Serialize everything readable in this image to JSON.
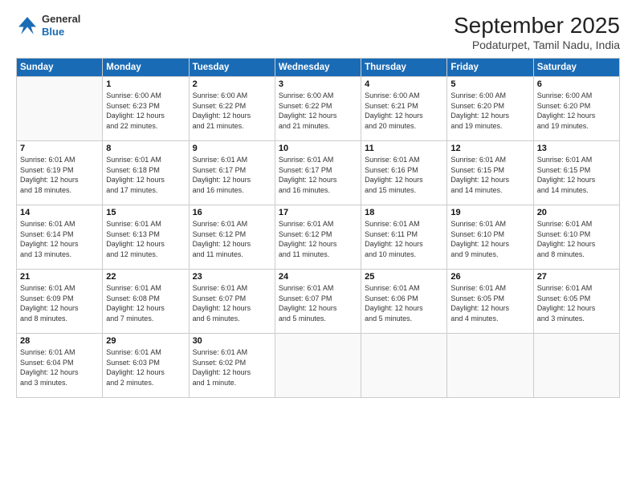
{
  "header": {
    "logo_line1": "General",
    "logo_line2": "Blue",
    "title": "September 2025",
    "subtitle": "Podaturpet, Tamil Nadu, India"
  },
  "weekdays": [
    "Sunday",
    "Monday",
    "Tuesday",
    "Wednesday",
    "Thursday",
    "Friday",
    "Saturday"
  ],
  "weeks": [
    [
      {
        "day": "",
        "info": ""
      },
      {
        "day": "1",
        "info": "Sunrise: 6:00 AM\nSunset: 6:23 PM\nDaylight: 12 hours\nand 22 minutes."
      },
      {
        "day": "2",
        "info": "Sunrise: 6:00 AM\nSunset: 6:22 PM\nDaylight: 12 hours\nand 21 minutes."
      },
      {
        "day": "3",
        "info": "Sunrise: 6:00 AM\nSunset: 6:22 PM\nDaylight: 12 hours\nand 21 minutes."
      },
      {
        "day": "4",
        "info": "Sunrise: 6:00 AM\nSunset: 6:21 PM\nDaylight: 12 hours\nand 20 minutes."
      },
      {
        "day": "5",
        "info": "Sunrise: 6:00 AM\nSunset: 6:20 PM\nDaylight: 12 hours\nand 19 minutes."
      },
      {
        "day": "6",
        "info": "Sunrise: 6:00 AM\nSunset: 6:20 PM\nDaylight: 12 hours\nand 19 minutes."
      }
    ],
    [
      {
        "day": "7",
        "info": "Sunrise: 6:01 AM\nSunset: 6:19 PM\nDaylight: 12 hours\nand 18 minutes."
      },
      {
        "day": "8",
        "info": "Sunrise: 6:01 AM\nSunset: 6:18 PM\nDaylight: 12 hours\nand 17 minutes."
      },
      {
        "day": "9",
        "info": "Sunrise: 6:01 AM\nSunset: 6:17 PM\nDaylight: 12 hours\nand 16 minutes."
      },
      {
        "day": "10",
        "info": "Sunrise: 6:01 AM\nSunset: 6:17 PM\nDaylight: 12 hours\nand 16 minutes."
      },
      {
        "day": "11",
        "info": "Sunrise: 6:01 AM\nSunset: 6:16 PM\nDaylight: 12 hours\nand 15 minutes."
      },
      {
        "day": "12",
        "info": "Sunrise: 6:01 AM\nSunset: 6:15 PM\nDaylight: 12 hours\nand 14 minutes."
      },
      {
        "day": "13",
        "info": "Sunrise: 6:01 AM\nSunset: 6:15 PM\nDaylight: 12 hours\nand 14 minutes."
      }
    ],
    [
      {
        "day": "14",
        "info": "Sunrise: 6:01 AM\nSunset: 6:14 PM\nDaylight: 12 hours\nand 13 minutes."
      },
      {
        "day": "15",
        "info": "Sunrise: 6:01 AM\nSunset: 6:13 PM\nDaylight: 12 hours\nand 12 minutes."
      },
      {
        "day": "16",
        "info": "Sunrise: 6:01 AM\nSunset: 6:12 PM\nDaylight: 12 hours\nand 11 minutes."
      },
      {
        "day": "17",
        "info": "Sunrise: 6:01 AM\nSunset: 6:12 PM\nDaylight: 12 hours\nand 11 minutes."
      },
      {
        "day": "18",
        "info": "Sunrise: 6:01 AM\nSunset: 6:11 PM\nDaylight: 12 hours\nand 10 minutes."
      },
      {
        "day": "19",
        "info": "Sunrise: 6:01 AM\nSunset: 6:10 PM\nDaylight: 12 hours\nand 9 minutes."
      },
      {
        "day": "20",
        "info": "Sunrise: 6:01 AM\nSunset: 6:10 PM\nDaylight: 12 hours\nand 8 minutes."
      }
    ],
    [
      {
        "day": "21",
        "info": "Sunrise: 6:01 AM\nSunset: 6:09 PM\nDaylight: 12 hours\nand 8 minutes."
      },
      {
        "day": "22",
        "info": "Sunrise: 6:01 AM\nSunset: 6:08 PM\nDaylight: 12 hours\nand 7 minutes."
      },
      {
        "day": "23",
        "info": "Sunrise: 6:01 AM\nSunset: 6:07 PM\nDaylight: 12 hours\nand 6 minutes."
      },
      {
        "day": "24",
        "info": "Sunrise: 6:01 AM\nSunset: 6:07 PM\nDaylight: 12 hours\nand 5 minutes."
      },
      {
        "day": "25",
        "info": "Sunrise: 6:01 AM\nSunset: 6:06 PM\nDaylight: 12 hours\nand 5 minutes."
      },
      {
        "day": "26",
        "info": "Sunrise: 6:01 AM\nSunset: 6:05 PM\nDaylight: 12 hours\nand 4 minutes."
      },
      {
        "day": "27",
        "info": "Sunrise: 6:01 AM\nSunset: 6:05 PM\nDaylight: 12 hours\nand 3 minutes."
      }
    ],
    [
      {
        "day": "28",
        "info": "Sunrise: 6:01 AM\nSunset: 6:04 PM\nDaylight: 12 hours\nand 3 minutes."
      },
      {
        "day": "29",
        "info": "Sunrise: 6:01 AM\nSunset: 6:03 PM\nDaylight: 12 hours\nand 2 minutes."
      },
      {
        "day": "30",
        "info": "Sunrise: 6:01 AM\nSunset: 6:02 PM\nDaylight: 12 hours\nand 1 minute."
      },
      {
        "day": "",
        "info": ""
      },
      {
        "day": "",
        "info": ""
      },
      {
        "day": "",
        "info": ""
      },
      {
        "day": "",
        "info": ""
      }
    ]
  ]
}
